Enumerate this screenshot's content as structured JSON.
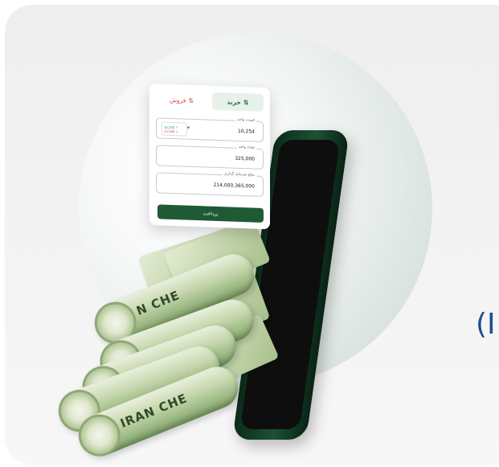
{
  "side_text": "(I",
  "trade": {
    "tabs": [
      {
        "label": "خرید",
        "icon": "buy-icon"
      },
      {
        "label": "فروش",
        "icon": "sell-icon"
      }
    ],
    "unit_price": {
      "label": "قیمت واحد",
      "value": "10,254"
    },
    "ask_up": "10,200 ↑",
    "ask_down": "10,300 ↓",
    "quantity": {
      "label": "تعداد واحد",
      "value": "325,000"
    },
    "total": {
      "label": "مبلغ سرمایه گذاری",
      "value": "214,000,365,000"
    },
    "pay_button": "پرداخت"
  },
  "rolls": {
    "text_1": "IRAN CHE",
    "text_2": "N CHE"
  },
  "colors": {
    "primary_green": "#1f5a35",
    "sell_red": "#d14b4b",
    "buy_green": "#1d6b3e",
    "side_text_blue": "#1d4f8c"
  }
}
